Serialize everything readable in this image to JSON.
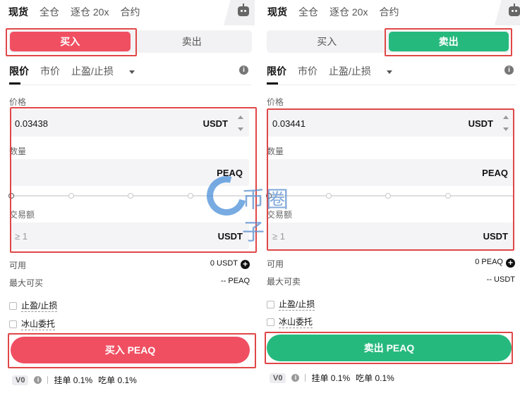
{
  "left": {
    "modes": [
      "现货",
      "全仓",
      "逐仓 20x",
      "合约"
    ],
    "side_tabs": {
      "buy": "买入",
      "sell": "卖出"
    },
    "order_types": {
      "limit": "限价",
      "market": "市价",
      "tpsl": "止盈/止损"
    },
    "price": {
      "label": "价格",
      "value": "0.03438",
      "unit": "USDT"
    },
    "amount": {
      "label": "数量",
      "unit": "PEAQ"
    },
    "total": {
      "label": "交易额",
      "placeholder": "≥ 1",
      "unit": "USDT"
    },
    "available": {
      "label": "可用",
      "value": "0 USDT"
    },
    "max": {
      "label": "最大可买",
      "value": "-- PEAQ"
    },
    "options": {
      "tpsl": "止盈/止损",
      "iceberg": "冰山委托"
    },
    "submit": "买入 PEAQ",
    "fees": {
      "vip": "V0",
      "maker": "挂单 0.1%",
      "taker": "吃单 0.1%"
    }
  },
  "right": {
    "modes": [
      "现货",
      "全仓",
      "逐仓 20x",
      "合约"
    ],
    "side_tabs": {
      "buy": "买入",
      "sell": "卖出"
    },
    "order_types": {
      "limit": "限价",
      "market": "市价",
      "tpsl": "止盈/止损"
    },
    "price": {
      "label": "价格",
      "value": "0.03441",
      "unit": "USDT"
    },
    "amount": {
      "label": "数量",
      "unit": "PEAQ"
    },
    "total": {
      "label": "交易额",
      "placeholder": "≥ 1",
      "unit": "USDT"
    },
    "available": {
      "label": "可用",
      "value": "0 PEAQ"
    },
    "max": {
      "label": "最大可卖",
      "value": "-- USDT"
    },
    "options": {
      "tpsl": "止盈/止损",
      "iceberg": "冰山委托"
    },
    "submit": "卖出 PEAQ",
    "fees": {
      "vip": "V0",
      "maker": "挂单 0.1%",
      "taker": "吃单 0.1%"
    }
  },
  "watermark": "币圈子",
  "colors": {
    "buy": "#f04f62",
    "sell": "#26b97e",
    "highlight": "#e04747"
  }
}
